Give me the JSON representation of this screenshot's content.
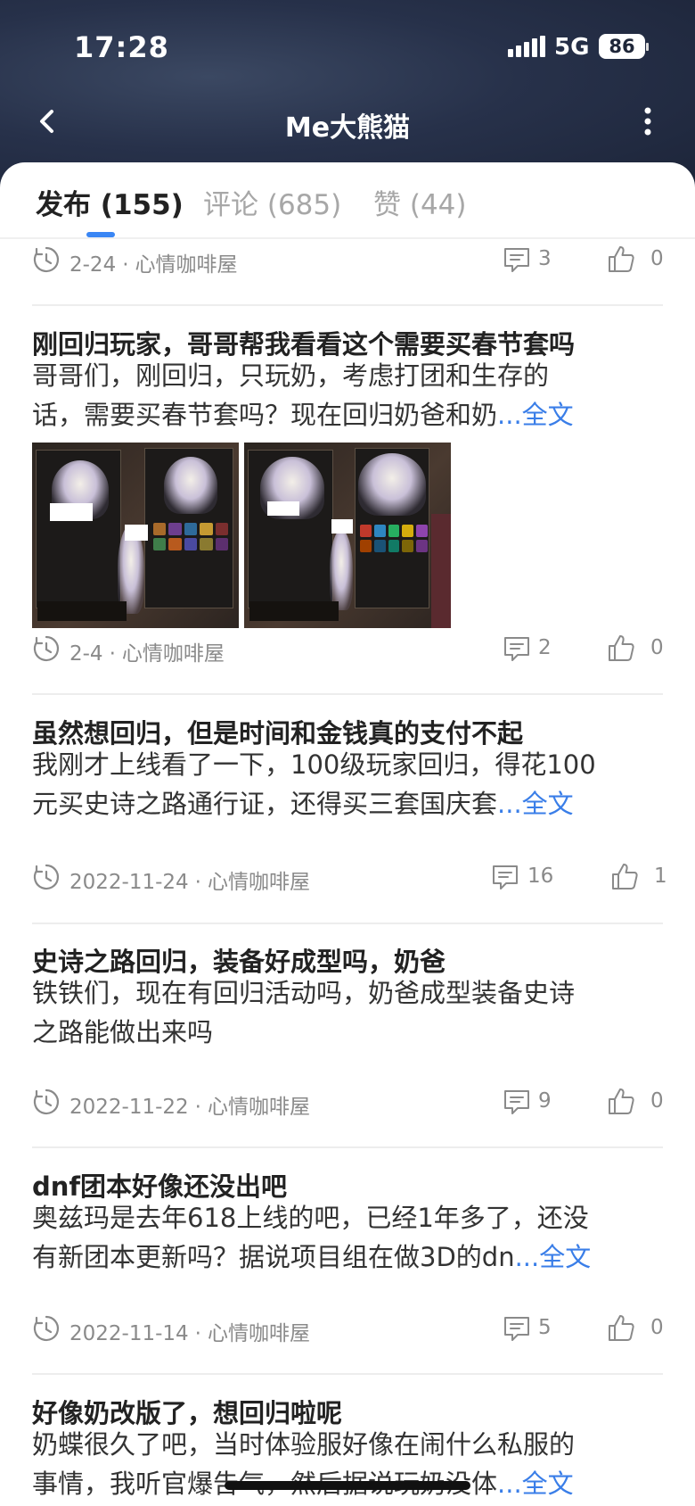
{
  "status_bar": {
    "time": "17:28",
    "network": "5G",
    "battery": "86"
  },
  "nav": {
    "title": "Me大熊猫"
  },
  "tabs": [
    {
      "label": "发布 (155)",
      "active": true
    },
    {
      "label": "评论 (685)",
      "active": false
    },
    {
      "label": "赞 (44)",
      "active": false
    }
  ],
  "posts": [
    {
      "date": "2-24",
      "community": "心情咖啡屋",
      "comments": "3",
      "likes": "0"
    },
    {
      "title": "刚回归玩家，哥哥帮我看看这个需要买春节套吗",
      "body_line1": "哥哥们，刚回归，只玩奶，考虑打团和生存的",
      "body_line2": "话，需要买春节套吗？现在回归奶爸和奶",
      "more": "...全文",
      "image_count": 2,
      "date": "2-4",
      "community": "心情咖啡屋",
      "comments": "2",
      "likes": "0"
    },
    {
      "title": "虽然想回归，但是时间和金钱真的支付不起",
      "body_line1": "我刚才上线看了一下，100级玩家回归，得花100",
      "body_line2": "元买史诗之路通行证，还得买三套国庆套",
      "more": "...全文",
      "date": "2022-11-24",
      "community": "心情咖啡屋",
      "comments": "16",
      "likes": "1"
    },
    {
      "title": "史诗之路回归，装备好成型吗，奶爸",
      "body_line1": "铁铁们，现在有回归活动吗，奶爸成型装备史诗",
      "body_line2": "之路能做出来吗",
      "date": "2022-11-22",
      "community": "心情咖啡屋",
      "comments": "9",
      "likes": "0"
    },
    {
      "title": "dnf团本好像还没出吧",
      "body_line1": "奥兹玛是去年618上线的吧，已经1年多了，还没",
      "body_line2": "有新团本更新吗？据说项目组在做3D的dn",
      "more": "...全文",
      "date": "2022-11-14",
      "community": "心情咖啡屋",
      "comments": "5",
      "likes": "0"
    },
    {
      "title": "好像奶改版了，想回归啦呢",
      "body_line1": "奶蝶很久了吧，当时体验服好像在闹什么私服的",
      "body_line2": "事情，我听官爆告气，然后据说玩奶没体",
      "more": "...全文"
    }
  ],
  "icons": {
    "back": "chevron-left",
    "more": "vertical-ellipsis",
    "clock": "clock-outline",
    "comment": "comment-outline",
    "like": "thumbs-up-outline"
  },
  "colors": {
    "accent": "#3a86f4",
    "link": "#3a7ee8",
    "header_bg": "#27314a"
  }
}
